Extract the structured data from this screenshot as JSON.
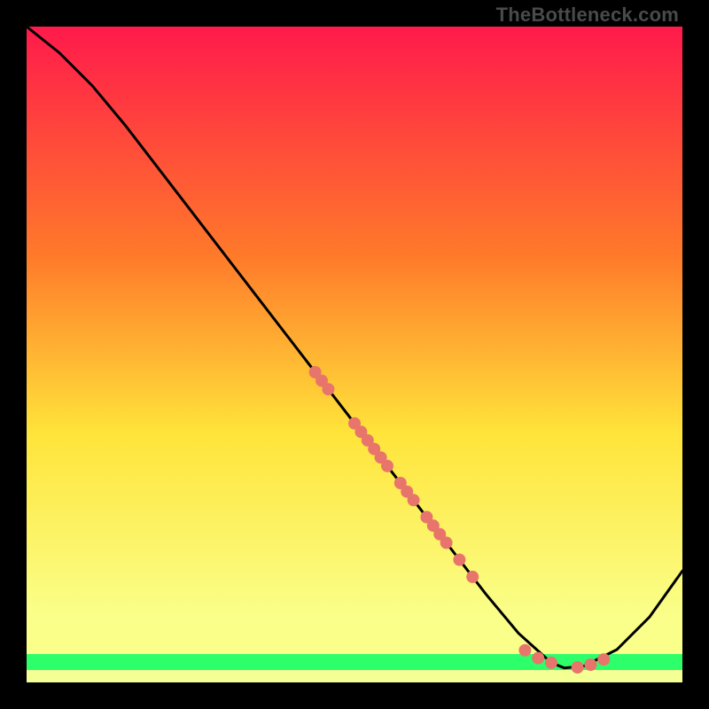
{
  "watermark": "TheBottleneck.com",
  "chart_data": {
    "type": "line",
    "title": "",
    "xlabel": "",
    "ylabel": "",
    "xlim": [
      0,
      100
    ],
    "ylim": [
      0,
      100
    ],
    "grid": false,
    "background_gradient": {
      "top": "#ff1a4b",
      "mid1": "#ff7a2a",
      "mid2": "#ffe43a",
      "mid3": "#faff8a",
      "bottom_band": "#2cff6a"
    },
    "series": [
      {
        "name": "curve",
        "type": "line",
        "x": [
          0,
          5,
          10,
          15,
          20,
          25,
          30,
          35,
          40,
          45,
          50,
          55,
          60,
          65,
          70,
          75,
          80,
          82,
          85,
          90,
          95,
          100
        ],
        "y": [
          100,
          96,
          91,
          85,
          78.5,
          72,
          65.5,
          59,
          52.5,
          46,
          39.5,
          33,
          26.5,
          20,
          13.5,
          7.5,
          3,
          2.2,
          2.5,
          5,
          10,
          17
        ],
        "stroke": "#000000",
        "width": 2
      },
      {
        "name": "markers-on-slope",
        "type": "scatter",
        "x": [
          44,
          45,
          46,
          50,
          51,
          52,
          53,
          54,
          55,
          57,
          58,
          59,
          61,
          62,
          63,
          64,
          66,
          68
        ],
        "y": [
          47.3,
          46,
          44.7,
          39.5,
          38.2,
          36.9,
          35.6,
          34.3,
          33,
          30.4,
          29.1,
          27.8,
          25.2,
          23.9,
          22.6,
          21.3,
          18.7,
          16.1
        ],
        "color": "#e8756b",
        "r": 7
      },
      {
        "name": "markers-at-trough",
        "type": "scatter",
        "x": [
          76,
          78,
          80,
          84,
          86,
          88
        ],
        "y": [
          4.9,
          3.7,
          3.0,
          2.3,
          2.7,
          3.5
        ],
        "color": "#e8756b",
        "r": 7
      }
    ]
  }
}
